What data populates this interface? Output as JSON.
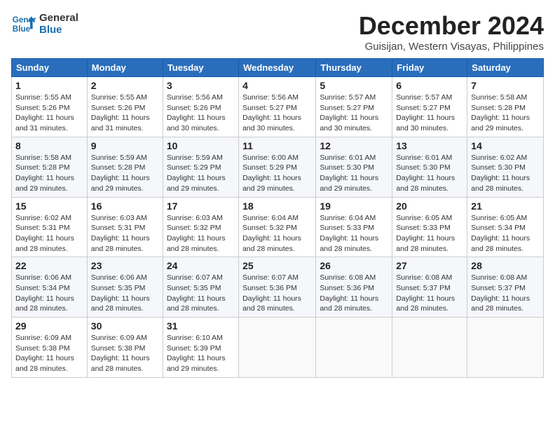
{
  "logo": {
    "line1": "General",
    "line2": "Blue"
  },
  "title": "December 2024",
  "location": "Guisijan, Western Visayas, Philippines",
  "weekdays": [
    "Sunday",
    "Monday",
    "Tuesday",
    "Wednesday",
    "Thursday",
    "Friday",
    "Saturday"
  ],
  "weeks": [
    [
      {
        "day": "1",
        "sunrise": "5:55 AM",
        "sunset": "5:26 PM",
        "daylight": "11 hours and 31 minutes."
      },
      {
        "day": "2",
        "sunrise": "5:55 AM",
        "sunset": "5:26 PM",
        "daylight": "11 hours and 31 minutes."
      },
      {
        "day": "3",
        "sunrise": "5:56 AM",
        "sunset": "5:26 PM",
        "daylight": "11 hours and 30 minutes."
      },
      {
        "day": "4",
        "sunrise": "5:56 AM",
        "sunset": "5:27 PM",
        "daylight": "11 hours and 30 minutes."
      },
      {
        "day": "5",
        "sunrise": "5:57 AM",
        "sunset": "5:27 PM",
        "daylight": "11 hours and 30 minutes."
      },
      {
        "day": "6",
        "sunrise": "5:57 AM",
        "sunset": "5:27 PM",
        "daylight": "11 hours and 30 minutes."
      },
      {
        "day": "7",
        "sunrise": "5:58 AM",
        "sunset": "5:28 PM",
        "daylight": "11 hours and 29 minutes."
      }
    ],
    [
      {
        "day": "8",
        "sunrise": "5:58 AM",
        "sunset": "5:28 PM",
        "daylight": "11 hours and 29 minutes."
      },
      {
        "day": "9",
        "sunrise": "5:59 AM",
        "sunset": "5:28 PM",
        "daylight": "11 hours and 29 minutes."
      },
      {
        "day": "10",
        "sunrise": "5:59 AM",
        "sunset": "5:29 PM",
        "daylight": "11 hours and 29 minutes."
      },
      {
        "day": "11",
        "sunrise": "6:00 AM",
        "sunset": "5:29 PM",
        "daylight": "11 hours and 29 minutes."
      },
      {
        "day": "12",
        "sunrise": "6:01 AM",
        "sunset": "5:30 PM",
        "daylight": "11 hours and 29 minutes."
      },
      {
        "day": "13",
        "sunrise": "6:01 AM",
        "sunset": "5:30 PM",
        "daylight": "11 hours and 28 minutes."
      },
      {
        "day": "14",
        "sunrise": "6:02 AM",
        "sunset": "5:30 PM",
        "daylight": "11 hours and 28 minutes."
      }
    ],
    [
      {
        "day": "15",
        "sunrise": "6:02 AM",
        "sunset": "5:31 PM",
        "daylight": "11 hours and 28 minutes."
      },
      {
        "day": "16",
        "sunrise": "6:03 AM",
        "sunset": "5:31 PM",
        "daylight": "11 hours and 28 minutes."
      },
      {
        "day": "17",
        "sunrise": "6:03 AM",
        "sunset": "5:32 PM",
        "daylight": "11 hours and 28 minutes."
      },
      {
        "day": "18",
        "sunrise": "6:04 AM",
        "sunset": "5:32 PM",
        "daylight": "11 hours and 28 minutes."
      },
      {
        "day": "19",
        "sunrise": "6:04 AM",
        "sunset": "5:33 PM",
        "daylight": "11 hours and 28 minutes."
      },
      {
        "day": "20",
        "sunrise": "6:05 AM",
        "sunset": "5:33 PM",
        "daylight": "11 hours and 28 minutes."
      },
      {
        "day": "21",
        "sunrise": "6:05 AM",
        "sunset": "5:34 PM",
        "daylight": "11 hours and 28 minutes."
      }
    ],
    [
      {
        "day": "22",
        "sunrise": "6:06 AM",
        "sunset": "5:34 PM",
        "daylight": "11 hours and 28 minutes."
      },
      {
        "day": "23",
        "sunrise": "6:06 AM",
        "sunset": "5:35 PM",
        "daylight": "11 hours and 28 minutes."
      },
      {
        "day": "24",
        "sunrise": "6:07 AM",
        "sunset": "5:35 PM",
        "daylight": "11 hours and 28 minutes."
      },
      {
        "day": "25",
        "sunrise": "6:07 AM",
        "sunset": "5:36 PM",
        "daylight": "11 hours and 28 minutes."
      },
      {
        "day": "26",
        "sunrise": "6:08 AM",
        "sunset": "5:36 PM",
        "daylight": "11 hours and 28 minutes."
      },
      {
        "day": "27",
        "sunrise": "6:08 AM",
        "sunset": "5:37 PM",
        "daylight": "11 hours and 28 minutes."
      },
      {
        "day": "28",
        "sunrise": "6:08 AM",
        "sunset": "5:37 PM",
        "daylight": "11 hours and 28 minutes."
      }
    ],
    [
      {
        "day": "29",
        "sunrise": "6:09 AM",
        "sunset": "5:38 PM",
        "daylight": "11 hours and 28 minutes."
      },
      {
        "day": "30",
        "sunrise": "6:09 AM",
        "sunset": "5:38 PM",
        "daylight": "11 hours and 28 minutes."
      },
      {
        "day": "31",
        "sunrise": "6:10 AM",
        "sunset": "5:39 PM",
        "daylight": "11 hours and 29 minutes."
      },
      null,
      null,
      null,
      null
    ]
  ]
}
